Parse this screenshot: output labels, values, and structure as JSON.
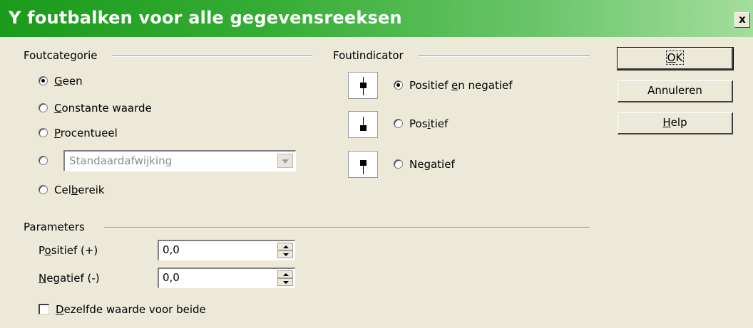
{
  "window": {
    "title": "Y foutbalken voor alle gegevensreeksen",
    "close_label": "x"
  },
  "error_category": {
    "heading": "Foutcategorie",
    "options": [
      {
        "pre": "",
        "key": "G",
        "post": "een",
        "checked": true
      },
      {
        "pre": "",
        "key": "C",
        "post": "onstante waarde",
        "checked": false
      },
      {
        "pre": "",
        "key": "P",
        "post": "rocentueel",
        "checked": false
      },
      {
        "pre": "Cel",
        "key": "b",
        "post": "ereik",
        "checked": false
      }
    ],
    "function_option_checked": false,
    "function_select_value": "Standaardafwijking"
  },
  "error_indicator": {
    "heading": "Foutindicator",
    "options": [
      {
        "pre": "Positief ",
        "key": "e",
        "post": "n negatief",
        "checked": true,
        "icon": "error-bar-both-icon"
      },
      {
        "pre": "Pos",
        "key": "i",
        "post": "tief",
        "checked": false,
        "icon": "error-bar-positive-icon"
      },
      {
        "pre": "Ne",
        "key": "g",
        "post": "atief",
        "checked": false,
        "icon": "error-bar-negative-icon"
      }
    ]
  },
  "parameters": {
    "heading": "Parameters",
    "positive": {
      "pre": "P",
      "key": "o",
      "post": "sitief (+)",
      "value": "0,0"
    },
    "negative": {
      "pre": "",
      "key": "N",
      "post": "egatief (-)",
      "value": "0,0"
    },
    "same_value": {
      "pre": "",
      "key": "D",
      "post": "ezelfde waarde voor beide",
      "checked": false
    }
  },
  "buttons": {
    "ok": {
      "pre": "",
      "key": "O",
      "post": "K"
    },
    "cancel": "Annuleren",
    "help": {
      "pre": "",
      "key": "H",
      "post": "elp"
    }
  },
  "colors": {
    "title_bar_start": "#1b9a1b",
    "title_bar_end": "#a3de9c",
    "dialog_bg": "#ece9d8"
  }
}
